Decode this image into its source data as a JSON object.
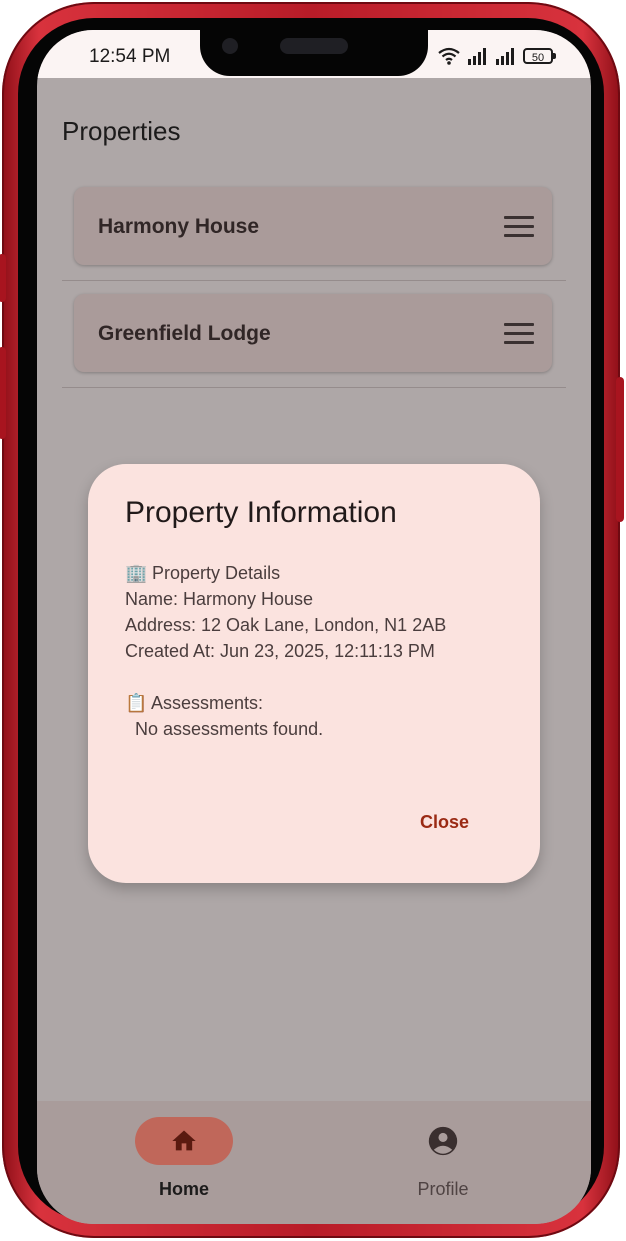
{
  "status_bar": {
    "time": "12:54 PM",
    "battery": "50",
    "wifi_icon": "wifi-icon",
    "signal_icon": "signal-icon"
  },
  "page": {
    "title": "Properties"
  },
  "properties": [
    {
      "name": "Harmony House",
      "icon": "menu-icon"
    },
    {
      "name": "Greenfield Lodge",
      "icon": "menu-icon"
    }
  ],
  "dialog": {
    "title": "Property Information",
    "details_heading_icon": "🏢",
    "details_heading": "Property Details",
    "name_line": "Name: Harmony House",
    "address_line": "Address: 12 Oak Lane, London, N1 2AB",
    "created_line": "Created At: Jun 23, 2025, 12:11:13 PM",
    "assessments_icon": "📋",
    "assessments_heading": "Assessments:",
    "assessments_empty": "No assessments found.",
    "close_label": "Close"
  },
  "nav": {
    "items": [
      {
        "label": "Home",
        "icon": "home-icon",
        "active": true
      },
      {
        "label": "Profile",
        "icon": "profile-icon",
        "active": false
      }
    ]
  },
  "colors": {
    "frame": "#b81c28",
    "scrim_background": "#aea7a7",
    "card": "#aa9b9a",
    "dialog": "#fbe3df",
    "accent": "#9a2a14",
    "nav_active_pill": "#c0675a"
  }
}
